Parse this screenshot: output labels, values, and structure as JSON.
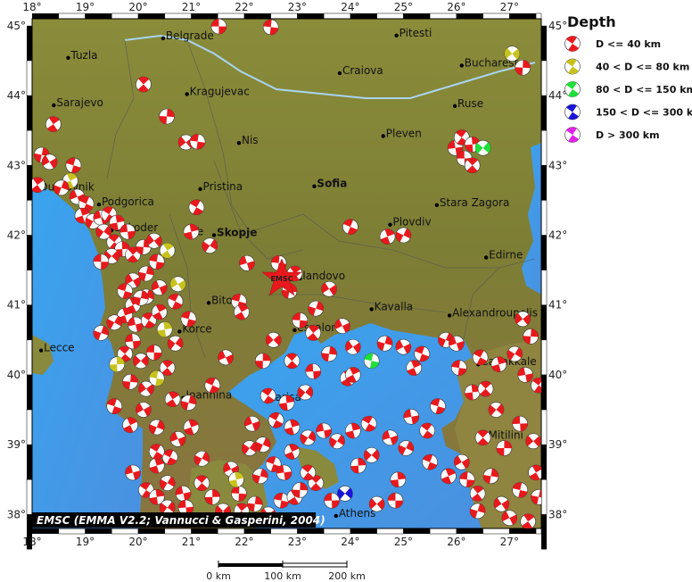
{
  "map": {
    "lon_ticks": [
      "18°",
      "19°",
      "20°",
      "21°",
      "22°",
      "23°",
      "24°",
      "25°",
      "26°",
      "27°"
    ],
    "lat_ticks": [
      "38°",
      "39°",
      "40°",
      "41°",
      "42°",
      "43°",
      "44°",
      "45°"
    ],
    "lon_range": [
      18,
      27.6
    ],
    "lat_range": [
      37.8,
      45.1
    ],
    "credit": "EMSC (EMMA V2.2; Vannucci & Gasperini, 2004)",
    "station_marker": "EMSC"
  },
  "cities": [
    {
      "name": "Belgrade",
      "lon": 20.47,
      "lat": 44.82
    },
    {
      "name": "Pitesti",
      "lon": 24.87,
      "lat": 44.86
    },
    {
      "name": "Tuzla",
      "lon": 18.68,
      "lat": 44.54
    },
    {
      "name": "Craiova",
      "lon": 23.8,
      "lat": 44.32
    },
    {
      "name": "Bucharest",
      "lon": 26.1,
      "lat": 44.43
    },
    {
      "name": "Sarajevo",
      "lon": 18.41,
      "lat": 43.86
    },
    {
      "name": "Kragujevac",
      "lon": 20.92,
      "lat": 44.02
    },
    {
      "name": "Ruse",
      "lon": 25.97,
      "lat": 43.85
    },
    {
      "name": "Nis",
      "lon": 21.9,
      "lat": 43.32
    },
    {
      "name": "Pleven",
      "lon": 24.62,
      "lat": 43.42
    },
    {
      "name": "Dubrovnik",
      "lon": 18.09,
      "lat": 42.65
    },
    {
      "name": "Pristina",
      "lon": 21.17,
      "lat": 42.66
    },
    {
      "name": "Sofia",
      "lon": 23.32,
      "lat": 42.7,
      "bold": true
    },
    {
      "name": "Podgorica",
      "lon": 19.26,
      "lat": 42.44
    },
    {
      "name": "Stara Zagora",
      "lon": 25.63,
      "lat": 42.43
    },
    {
      "name": "Shkoder",
      "lon": 19.5,
      "lat": 42.07
    },
    {
      "name": "Te",
      "lon": 20.97,
      "lat": 42.01
    },
    {
      "name": "Skopje",
      "lon": 21.43,
      "lat": 42.0,
      "bold": true
    },
    {
      "name": "Plovdiv",
      "lon": 24.75,
      "lat": 42.15
    },
    {
      "name": "Edirne",
      "lon": 26.56,
      "lat": 41.68
    },
    {
      "name": "landovo",
      "lon": 23.05,
      "lat": 41.38
    },
    {
      "name": "Bitola",
      "lon": 21.33,
      "lat": 41.03
    },
    {
      "name": "Kavalla",
      "lon": 24.4,
      "lat": 40.94
    },
    {
      "name": "Alexandroupolis",
      "lon": 25.87,
      "lat": 40.85
    },
    {
      "name": "Korce",
      "lon": 20.78,
      "lat": 40.62
    },
    {
      "name": "essaloniki",
      "lon": 22.95,
      "lat": 40.64
    },
    {
      "name": "Lecce",
      "lon": 18.17,
      "lat": 40.35
    },
    {
      "name": "Canakkale",
      "lon": 26.41,
      "lat": 40.15
    },
    {
      "name": "Ioannina",
      "lon": 20.85,
      "lat": 39.67
    },
    {
      "name": "Larisa",
      "lon": 22.42,
      "lat": 39.64
    },
    {
      "name": "Mitilini",
      "lon": 26.55,
      "lat": 39.1
    },
    {
      "name": "Athens",
      "lon": 23.73,
      "lat": 37.98
    }
  ],
  "legend": {
    "title": "Depth",
    "items": [
      {
        "label": "D <= 40 km",
        "color": "#e8191d"
      },
      {
        "label": "40 < D <= 80 km",
        "color": "#c8c21e"
      },
      {
        "label": "80 < D <= 150 km",
        "color": "#1fe03a"
      },
      {
        "label": "150 < D <= 300 km",
        "color": "#1a14d8"
      },
      {
        "label": "D > 300 km",
        "color": "#e022e8"
      }
    ]
  },
  "scale_bar": {
    "labels": [
      "0 km",
      "100 km",
      "200 km"
    ]
  },
  "colors": {
    "sea": "#3f9ee8",
    "sea_deep": "#5a86d6",
    "land_low": "#7a8a3a",
    "land_high": "#a58a4c",
    "mechanism_red": "#e8191d"
  },
  "events": [
    [
      21.52,
      44.99,
      0
    ],
    [
      20.1,
      44.16,
      0
    ],
    [
      20.54,
      43.7,
      0
    ],
    [
      20.9,
      43.33,
      0
    ],
    [
      21.12,
      43.34,
      0
    ],
    [
      18.4,
      43.59,
      0
    ],
    [
      18.18,
      43.15,
      0
    ],
    [
      18.33,
      43.05,
      0
    ],
    [
      18.78,
      43.0,
      0
    ],
    [
      18.72,
      42.78,
      1
    ],
    [
      18.55,
      42.68,
      0
    ],
    [
      18.85,
      42.55,
      0
    ],
    [
      19.02,
      42.45,
      0
    ],
    [
      18.95,
      42.28,
      0
    ],
    [
      19.15,
      42.2,
      0
    ],
    [
      19.3,
      42.25,
      0
    ],
    [
      19.45,
      42.3,
      0
    ],
    [
      19.6,
      42.18,
      0
    ],
    [
      19.35,
      42.05,
      0
    ],
    [
      19.8,
      42.05,
      0
    ],
    [
      19.55,
      41.9,
      0
    ],
    [
      19.7,
      41.8,
      0
    ],
    [
      19.5,
      41.7,
      0
    ],
    [
      19.3,
      41.62,
      0
    ],
    [
      19.9,
      41.72,
      0
    ],
    [
      20.1,
      41.83,
      0
    ],
    [
      20.3,
      41.92,
      0
    ],
    [
      20.35,
      41.62,
      0
    ],
    [
      20.55,
      41.78,
      1
    ],
    [
      20.15,
      41.45,
      0
    ],
    [
      19.9,
      41.35,
      0
    ],
    [
      19.75,
      41.2,
      0
    ],
    [
      19.9,
      41.0,
      0
    ],
    [
      20.15,
      41.12,
      0
    ],
    [
      20.4,
      41.25,
      0
    ],
    [
      20.7,
      41.05,
      0
    ],
    [
      19.75,
      40.85,
      0
    ],
    [
      19.55,
      40.75,
      0
    ],
    [
      19.95,
      40.72,
      0
    ],
    [
      20.2,
      40.78,
      0
    ],
    [
      20.5,
      40.65,
      1
    ],
    [
      20.7,
      40.45,
      0
    ],
    [
      19.9,
      40.48,
      0
    ],
    [
      19.75,
      40.3,
      0
    ],
    [
      19.6,
      40.15,
      1
    ],
    [
      20.05,
      40.2,
      0
    ],
    [
      20.3,
      40.32,
      0
    ],
    [
      20.55,
      40.1,
      0
    ],
    [
      19.85,
      39.9,
      0
    ],
    [
      20.15,
      39.8,
      0
    ],
    [
      20.35,
      39.95,
      1
    ],
    [
      20.65,
      39.65,
      0
    ],
    [
      20.95,
      39.6,
      0
    ],
    [
      20.1,
      39.5,
      0
    ],
    [
      19.55,
      39.55,
      0
    ],
    [
      19.85,
      39.28,
      0
    ],
    [
      20.35,
      39.25,
      0
    ],
    [
      20.75,
      39.08,
      0
    ],
    [
      20.6,
      38.82,
      0
    ],
    [
      20.35,
      38.7,
      0
    ],
    [
      20.55,
      38.45,
      0
    ],
    [
      20.85,
      38.3,
      0
    ],
    [
      20.15,
      38.35,
      0
    ],
    [
      20.35,
      38.25,
      0
    ],
    [
      20.55,
      38.1,
      0
    ],
    [
      20.9,
      38.1,
      0
    ],
    [
      21.2,
      38.45,
      0
    ],
    [
      21.4,
      38.25,
      0
    ],
    [
      21.6,
      38.05,
      0
    ],
    [
      21.9,
      38.3,
      0
    ],
    [
      21.95,
      38.05,
      0
    ],
    [
      22.2,
      38.15,
      0
    ],
    [
      22.45,
      38.0,
      0
    ],
    [
      22.7,
      38.2,
      0
    ],
    [
      22.95,
      38.25,
      0
    ],
    [
      22.3,
      38.55,
      0
    ],
    [
      21.75,
      38.65,
      0
    ],
    [
      22.55,
      38.72,
      0
    ],
    [
      22.9,
      38.9,
      0
    ],
    [
      22.35,
      39.0,
      0
    ],
    [
      22.15,
      39.3,
      0
    ],
    [
      22.6,
      39.35,
      0
    ],
    [
      22.9,
      39.25,
      0
    ],
    [
      23.2,
      39.1,
      0
    ],
    [
      23.5,
      39.2,
      0
    ],
    [
      22.45,
      39.7,
      0
    ],
    [
      22.8,
      39.6,
      0
    ],
    [
      23.15,
      39.75,
      0
    ],
    [
      23.3,
      40.05,
      0
    ],
    [
      22.9,
      40.2,
      0
    ],
    [
      22.35,
      40.2,
      0
    ],
    [
      22.55,
      40.5,
      0
    ],
    [
      23.05,
      40.78,
      0
    ],
    [
      23.3,
      40.6,
      0
    ],
    [
      23.6,
      40.3,
      0
    ],
    [
      24.05,
      40.4,
      0
    ],
    [
      24.4,
      40.2,
      2
    ],
    [
      23.95,
      39.95,
      0
    ],
    [
      24.65,
      40.45,
      0
    ],
    [
      25.0,
      40.4,
      0
    ],
    [
      25.35,
      40.3,
      0
    ],
    [
      25.2,
      40.1,
      0
    ],
    [
      25.8,
      40.5,
      0
    ],
    [
      26.0,
      40.45,
      0
    ],
    [
      26.45,
      40.25,
      0
    ],
    [
      26.8,
      40.15,
      0
    ],
    [
      27.1,
      40.3,
      0
    ],
    [
      27.3,
      40.0,
      0
    ],
    [
      27.55,
      39.85,
      0
    ],
    [
      26.3,
      39.75,
      0
    ],
    [
      26.75,
      39.5,
      0
    ],
    [
      27.2,
      39.3,
      0
    ],
    [
      26.5,
      39.1,
      0
    ],
    [
      26.9,
      38.95,
      0
    ],
    [
      27.45,
      39.05,
      0
    ],
    [
      26.2,
      38.5,
      0
    ],
    [
      26.4,
      38.3,
      0
    ],
    [
      26.65,
      38.55,
      0
    ],
    [
      26.85,
      38.15,
      0
    ],
    [
      27.2,
      38.35,
      0
    ],
    [
      27.5,
      38.6,
      0
    ],
    [
      26.4,
      38.05,
      0
    ],
    [
      27.0,
      37.95,
      0
    ],
    [
      25.5,
      38.75,
      0
    ],
    [
      25.85,
      38.55,
      0
    ],
    [
      25.05,
      38.95,
      0
    ],
    [
      24.75,
      39.1,
      0
    ],
    [
      24.35,
      39.3,
      0
    ],
    [
      24.05,
      39.2,
      0
    ],
    [
      23.75,
      39.05,
      0
    ],
    [
      25.15,
      39.4,
      0
    ],
    [
      25.45,
      39.2,
      0
    ],
    [
      24.9,
      38.5,
      0
    ],
    [
      23.9,
      38.3,
      3
    ],
    [
      23.65,
      38.2,
      0
    ],
    [
      23.35,
      38.45,
      0
    ],
    [
      23.05,
      38.35,
      0
    ],
    [
      24.5,
      38.15,
      0
    ],
    [
      22.65,
      41.6,
      0
    ],
    [
      22.95,
      41.45,
      0
    ],
    [
      22.85,
      41.2,
      0
    ],
    [
      23.6,
      41.23,
      0
    ],
    [
      21.9,
      41.05,
      0
    ],
    [
      21.95,
      40.9,
      0
    ],
    [
      23.35,
      40.95,
      0
    ],
    [
      23.85,
      40.7,
      0
    ],
    [
      24.0,
      42.12,
      0
    ],
    [
      24.7,
      41.98,
      0
    ],
    [
      25.0,
      42.0,
      0
    ],
    [
      22.05,
      41.6,
      0
    ],
    [
      21.1,
      42.4,
      0
    ],
    [
      21.0,
      42.05,
      0
    ],
    [
      21.35,
      41.85,
      0
    ],
    [
      25.98,
      43.25,
      0
    ],
    [
      26.1,
      43.4,
      0
    ],
    [
      26.3,
      43.3,
      0
    ],
    [
      26.5,
      43.25,
      2
    ],
    [
      26.15,
      43.1,
      0
    ],
    [
      26.3,
      43.0,
      0
    ],
    [
      27.25,
      44.4,
      0
    ],
    [
      27.05,
      44.6,
      1
    ],
    [
      22.5,
      44.98,
      0
    ],
    [
      18.1,
      42.72,
      0
    ],
    [
      20.05,
      41.1,
      0
    ],
    [
      20.75,
      41.3,
      1
    ],
    [
      20.95,
      40.8,
      0
    ],
    [
      20.4,
      40.9,
      0
    ],
    [
      19.3,
      40.6,
      0
    ],
    [
      21.65,
      40.25,
      0
    ],
    [
      21.4,
      39.85,
      0
    ],
    [
      21.0,
      39.25,
      0
    ],
    [
      21.2,
      38.8,
      0
    ],
    [
      19.9,
      38.6,
      0
    ],
    [
      20.35,
      38.9,
      0
    ],
    [
      21.85,
      38.5,
      1
    ],
    [
      22.1,
      38.95,
      0
    ],
    [
      22.75,
      38.6,
      0
    ],
    [
      23.2,
      38.6,
      0
    ],
    [
      24.15,
      38.7,
      0
    ],
    [
      24.4,
      38.85,
      0
    ],
    [
      24.85,
      38.2,
      0
    ],
    [
      26.55,
      39.8,
      0
    ],
    [
      27.4,
      40.55,
      0
    ],
    [
      27.25,
      40.8,
      0
    ],
    [
      26.05,
      40.1,
      0
    ],
    [
      27.35,
      37.9,
      0
    ],
    [
      27.55,
      38.25,
      0
    ],
    [
      26.1,
      38.75,
      0
    ],
    [
      25.65,
      39.55,
      0
    ],
    [
      24.05,
      40.0,
      0
    ]
  ]
}
